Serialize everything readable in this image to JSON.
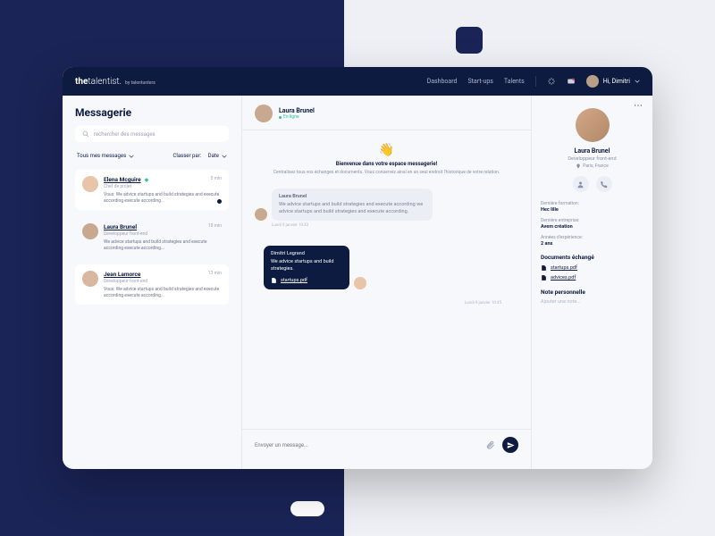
{
  "brand": {
    "part1": "the",
    "part2": "talentist.",
    "sub": "by talentunters"
  },
  "nav": {
    "dashboard": "Dashboard",
    "startups": "Start-ups",
    "talents": "Talents",
    "greeting": "Hi, Dimitri"
  },
  "page": {
    "title": "Messagerie"
  },
  "search": {
    "placeholder": "rechercher des messages"
  },
  "filters": {
    "all": "Tous mes messages",
    "sort_label": "Classer par:",
    "sort_value": "Date"
  },
  "conversations": [
    {
      "name": "Elena Mcguire",
      "role": "Chef de projet",
      "preview": "Vous: We advice startups and build strategies and execute according execute according...",
      "time": "5 min",
      "badge": true,
      "unread": true
    },
    {
      "name": "Laura Brunel",
      "role": "Développeur front-end",
      "preview": "We advice startups and build strategies and execute according execute according...",
      "time": "10 min"
    },
    {
      "name": "Jean Lamorce",
      "role": "Développeur front-end",
      "preview": "Vous: We advice startups and build strategies and execute according execute according...",
      "time": "13 min"
    }
  ],
  "chat": {
    "name": "Laura Brunel",
    "status": "En ligne",
    "welcome": {
      "title": "Bienvenue dans votre espace messagerie!",
      "sub": "Centralisez tous vos échanges et documents. Vous conservez ainsi en un seul endroit l'historique de votre relation."
    },
    "messages": [
      {
        "from": "Laura Brunel",
        "text": "We advice startups and build strategies and execute according we advice startups and build strategies and execute according.",
        "ts": "Lundi 9 janvier 10:43",
        "mine": false
      },
      {
        "from": "Dimitri Legrand",
        "text": "We advice startups and build strategies.",
        "attachment": "startups.pdf",
        "ts": "Lundi 9 janvier 10:45",
        "mine": true
      }
    ],
    "composer": "Envoyer un message..."
  },
  "profile": {
    "name": "Laura Brunel",
    "role": "Developpeur front-end",
    "location": "Paris, France",
    "meta": [
      {
        "label": "Dernière formation:",
        "value": "Hec lille"
      },
      {
        "label": "Dernière entreprise:",
        "value": "Avem création"
      },
      {
        "label": "Années d'expérience:",
        "value": "2 ans"
      }
    ],
    "docs_title": "Documents échangé",
    "docs": [
      "startups.pdf",
      "advices.pdf"
    ],
    "note_title": "Note personnelle",
    "note_placeholder": "Ajouter une note..."
  }
}
